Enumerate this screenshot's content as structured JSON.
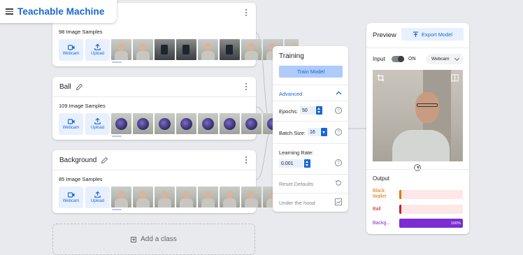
{
  "app": {
    "title": "Teachable Machine"
  },
  "classes": [
    {
      "name": "",
      "samples": "98 Image Samples",
      "webcam_label": "Webcam",
      "upload_label": "Upload",
      "thumbs": [
        "gray",
        "gray",
        "dark",
        "dark",
        "gray",
        "dark",
        "gray",
        "gray",
        "gray"
      ]
    },
    {
      "name": "Ball",
      "samples": "109 Image Samples",
      "webcam_label": "Webcam",
      "upload_label": "Upload",
      "thumbs": [
        "ball",
        "ball",
        "ball",
        "ball",
        "ball",
        "ball",
        "ball",
        "ball",
        "ball"
      ]
    },
    {
      "name": "Background",
      "samples": "85 Image Samples",
      "webcam_label": "Webcam",
      "upload_label": "Upload",
      "thumbs": [
        "gray",
        "gray",
        "gray",
        "gray",
        "gray",
        "gray",
        "gray",
        "gray",
        "gray"
      ]
    }
  ],
  "add_class": {
    "label": "Add a class"
  },
  "training": {
    "title": "Training",
    "train_button": "Train Model",
    "advanced_label": "Advanced",
    "epochs_label": "Epochs:",
    "epochs_value": "50",
    "batch_label": "Batch Size:",
    "batch_value": "16",
    "lr_label": "Learning Rate:",
    "lr_value": "0.001",
    "reset_label": "Reset Defaults",
    "hood_label": "Under the hood",
    "help_glyph": "?"
  },
  "preview": {
    "title": "Preview",
    "export_button": "Export Model",
    "input_label": "Input",
    "toggle_state": "ON",
    "source_select": "Webcam",
    "output_title": "Output",
    "outputs": [
      {
        "label": "Black Wallet",
        "percent": 0,
        "percent_text": "",
        "color": "#e37400"
      },
      {
        "label": "Ball",
        "percent": 0,
        "percent_text": "",
        "color": "#c5221f"
      },
      {
        "label": "Backg...",
        "percent": 100,
        "percent_text": "100%",
        "color": "#7b2cd4"
      }
    ]
  },
  "colors": {
    "accent": "#1967d2",
    "accent_light": "#e8f0fe",
    "purple": "#7b2cd4"
  }
}
